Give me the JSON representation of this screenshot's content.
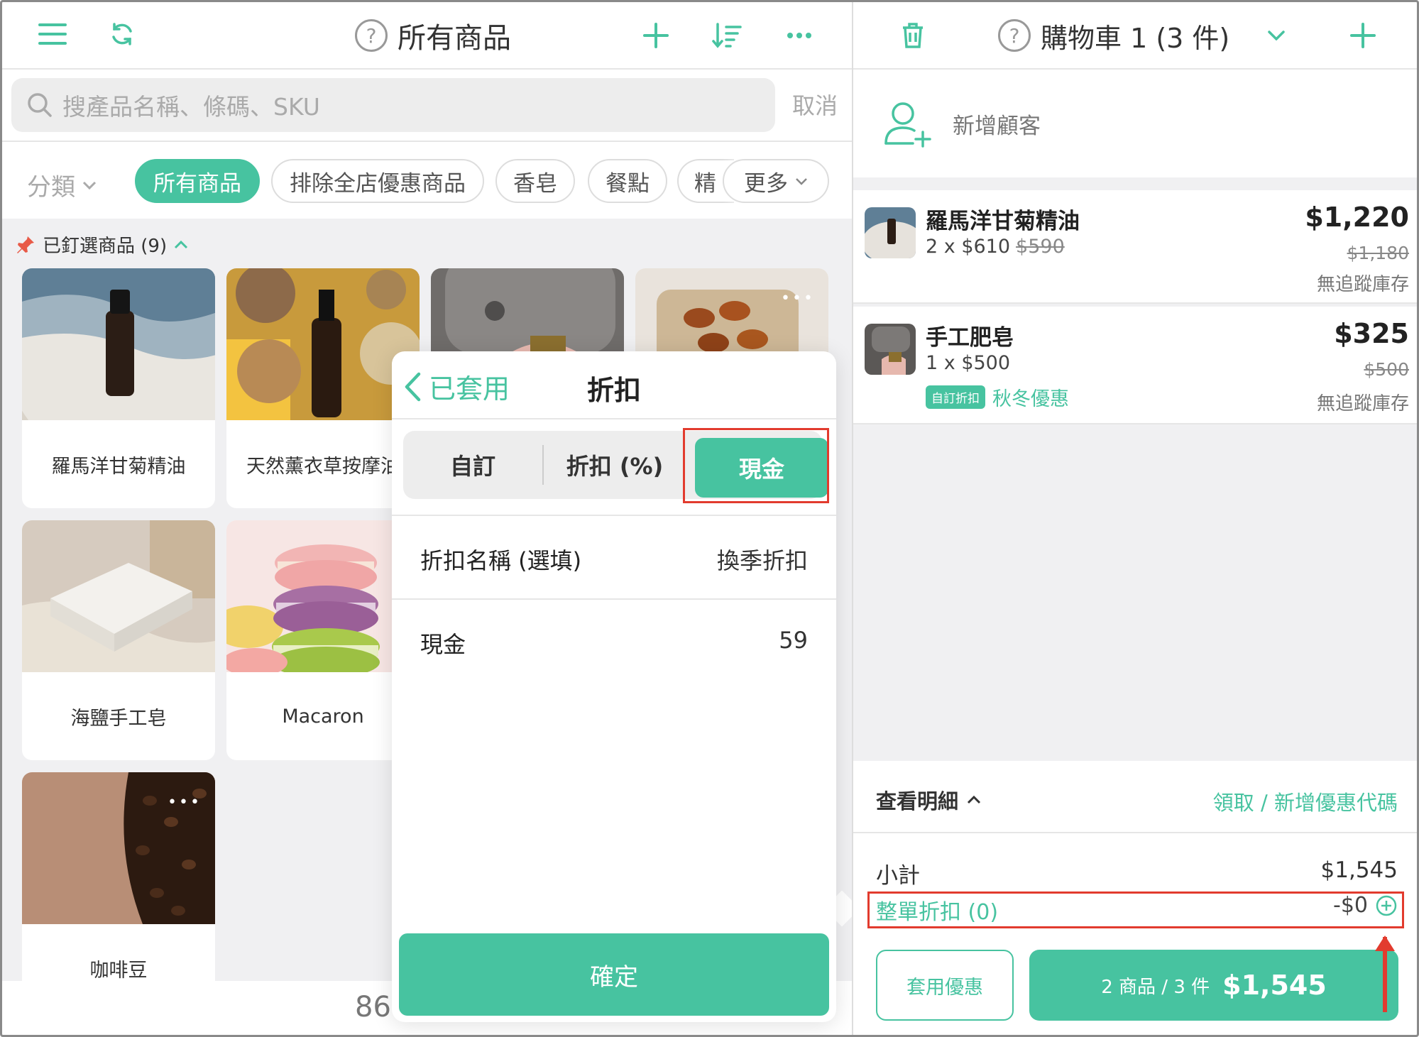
{
  "left": {
    "title": "所有商品",
    "search_placeholder": "搜產品名稱、條碼、SKU",
    "cancel_label": "取消",
    "category_label": "分類",
    "chips": [
      "所有商品",
      "排除全店優惠商品",
      "香皂",
      "餐點",
      "精",
      "更多"
    ],
    "pinned_label": "已釘選商品 (9)",
    "products": [
      {
        "name": "羅馬洋甘菊精油"
      },
      {
        "name": "天然薰衣草按摩油"
      },
      {
        "name": ""
      },
      {
        "name": ""
      },
      {
        "name": "海鹽手工皂"
      },
      {
        "name": "Macaron"
      },
      {
        "name": "咖啡豆"
      }
    ],
    "bottom_number": "86"
  },
  "popover": {
    "back_label": "已套用",
    "title": "折扣",
    "segments": [
      "自訂",
      "折扣 (%)",
      "現金"
    ],
    "selected_segment": "現金",
    "name_label": "折扣名稱 (選填)",
    "name_value": "換季折扣",
    "cash_label": "現金",
    "cash_value": "59",
    "confirm_label": "確定"
  },
  "right": {
    "cart_title": "購物車 1 (3 件)",
    "add_customer_label": "新增顧客",
    "items": [
      {
        "name": "羅馬洋甘菊精油",
        "qty_price": "2 x $610",
        "qty_orig": "$590",
        "price": "$1,220",
        "orig": "$1,180",
        "stock": "無追蹤庫存"
      },
      {
        "name": "手工肥皂",
        "qty_price": "1 x $500",
        "qty_orig": "",
        "price": "$325",
        "orig": "$500",
        "stock": "無追蹤庫存",
        "tag": "自訂折扣",
        "tag_text": "秋冬優惠"
      }
    ],
    "detail_label": "查看明細",
    "coupon_label": "領取 / 新增優惠代碼",
    "subtotal_label": "小計",
    "subtotal_value": "$1,545",
    "order_discount_label": "整單折扣 (0)",
    "order_discount_value": "-$0",
    "apply_label": "套用優惠",
    "pay_count": "2 商品 / 3 件",
    "pay_amount": "$1,545"
  },
  "colors": {
    "accent": "#47c3a0",
    "highlight": "#e23b2e"
  }
}
